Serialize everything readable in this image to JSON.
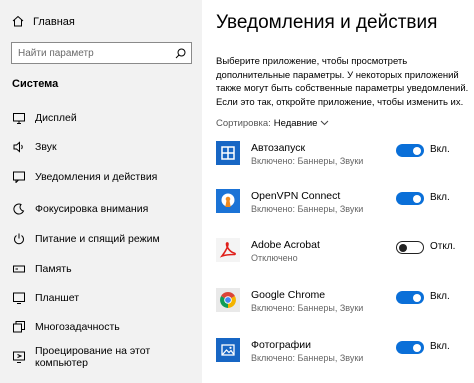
{
  "sidebar": {
    "home_label": "Главная",
    "search_placeholder": "Найти параметр",
    "section_title": "Система",
    "items": [
      {
        "label": "Дисплей",
        "icon": "display-icon"
      },
      {
        "label": "Звук",
        "icon": "sound-icon"
      },
      {
        "label": "Уведомления и действия",
        "icon": "notifications-icon",
        "selected": true
      },
      {
        "label": "Фокусировка внимания",
        "icon": "focus-assist-icon"
      },
      {
        "label": "Питание и спящий режим",
        "icon": "power-icon"
      },
      {
        "label": "Память",
        "icon": "storage-icon"
      },
      {
        "label": "Планшет",
        "icon": "tablet-icon"
      },
      {
        "label": "Многозадачность",
        "icon": "multitasking-icon"
      },
      {
        "label": "Проецирование на этот компьютер",
        "icon": "projecting-icon"
      }
    ]
  },
  "main": {
    "title": "Уведомления и действия",
    "description": "Выберите приложение, чтобы просмотреть дополнительные параметры. У некоторых приложений также могут быть собственные параметры уведомлений. Если это так, откройте приложение, чтобы изменить их.",
    "sort_label": "Сортировка:",
    "sort_value": "Недавние",
    "apps": [
      {
        "name": "Автозапуск",
        "status": "Включено: Баннеры, Звуки",
        "toggle_on": true,
        "toggle_label": "Вкл.",
        "icon": "autoplay-icon"
      },
      {
        "name": "OpenVPN Connect",
        "status": "Включено: Баннеры, Звуки",
        "toggle_on": true,
        "toggle_label": "Вкл.",
        "icon": "openvpn-icon"
      },
      {
        "name": "Adobe Acrobat",
        "status": "Отключено",
        "toggle_on": false,
        "toggle_label": "Откл.",
        "icon": "adobe-acrobat-icon"
      },
      {
        "name": "Google Chrome",
        "status": "Включено: Баннеры, Звуки",
        "toggle_on": true,
        "toggle_label": "Вкл.",
        "icon": "chrome-icon"
      },
      {
        "name": "Фотографии",
        "status": "Включено: Баннеры, Звуки",
        "toggle_on": true,
        "toggle_label": "Вкл.",
        "icon": "photos-icon"
      }
    ]
  },
  "colors": {
    "accent": "#0a6fd8",
    "sidebar_bg": "#f2f2f2"
  }
}
